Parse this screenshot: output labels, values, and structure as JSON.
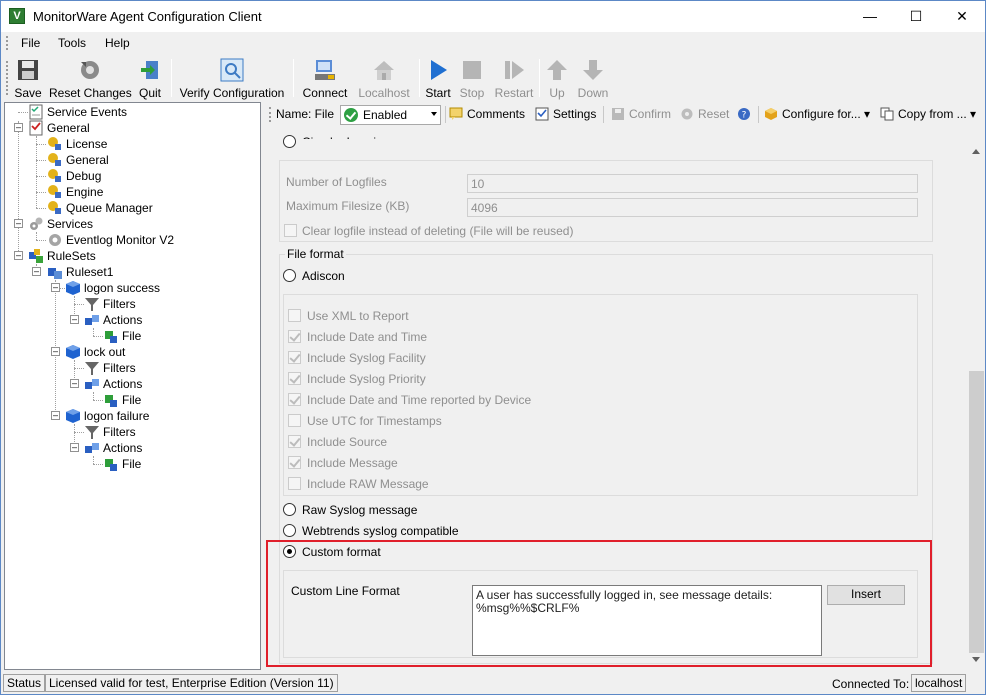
{
  "window": {
    "title": "MonitorWare Agent Configuration Client",
    "controls": {
      "minimize": "—",
      "maximize": "☐",
      "close": "✕"
    }
  },
  "menu": [
    "File",
    "Tools",
    "Help"
  ],
  "toolbar": {
    "save": "Save",
    "reset_changes": "Reset Changes",
    "quit": "Quit",
    "verify": "Verify Configuration",
    "connect": "Connect",
    "localhost": "Localhost",
    "start": "Start",
    "stop": "Stop",
    "restart": "Restart",
    "up": "Up",
    "down": "Down"
  },
  "tree": {
    "service_events": "Service Events",
    "general": "General",
    "license": "License",
    "general_sub": "General",
    "debug": "Debug",
    "engine": "Engine",
    "queue_manager": "Queue Manager",
    "services": "Services",
    "eventlog_monitor": "Eventlog Monitor V2",
    "rulesets": "RuleSets",
    "ruleset1": "Ruleset1",
    "logon_success": "logon success",
    "lock_out": "lock out",
    "logon_failure": "logon failure",
    "filters": "Filters",
    "actions": "Actions",
    "file": "File"
  },
  "action_toolbar": {
    "name_label": "Name: File",
    "state": "Enabled",
    "comments": "Comments",
    "settings": "Settings",
    "confirm": "Confirm",
    "reset": "Reset",
    "configure_for": "Configure for...",
    "copy_from": "Copy from ..."
  },
  "circular": {
    "radio_label": "Circular Logging",
    "number_of_logfiles_label": "Number of Logfiles",
    "number_of_logfiles_value": "10",
    "max_filesize_label": "Maximum Filesize (KB)",
    "max_filesize_value": "4096",
    "clear_logfile_label": "Clear logfile instead of deleting (File will be reused)"
  },
  "file_format": {
    "group_title": "File format",
    "adiscon": "Adiscon",
    "options": [
      {
        "label": "Use XML to Report",
        "checked": false
      },
      {
        "label": "Include Date and Time",
        "checked": true
      },
      {
        "label": "Include Syslog Facility",
        "checked": true
      },
      {
        "label": "Include Syslog Priority",
        "checked": true
      },
      {
        "label": "Include Date and Time reported by Device",
        "checked": true
      },
      {
        "label": "Use UTC for Timestamps",
        "checked": false
      },
      {
        "label": "Include Source",
        "checked": true
      },
      {
        "label": "Include Message",
        "checked": true
      },
      {
        "label": "Include RAW Message",
        "checked": false
      }
    ],
    "raw_syslog": "Raw Syslog message",
    "webtrends": "Webtrends syslog compatible",
    "custom_format": "Custom format",
    "custom_line_format_label": "Custom Line Format",
    "custom_line_format_value": "A user has successfully logged in, see message details:\n%msg%%$CRLF%",
    "insert_button": "Insert"
  },
  "status": {
    "status_label": "Status",
    "license_text": "Licensed valid for test, Enterprise Edition (Version 11)",
    "connected_label": "Connected To:",
    "connected_value": "localhost"
  },
  "colors": {
    "highlight_border": "#e01f2b",
    "window_border": "#5c88c6"
  }
}
